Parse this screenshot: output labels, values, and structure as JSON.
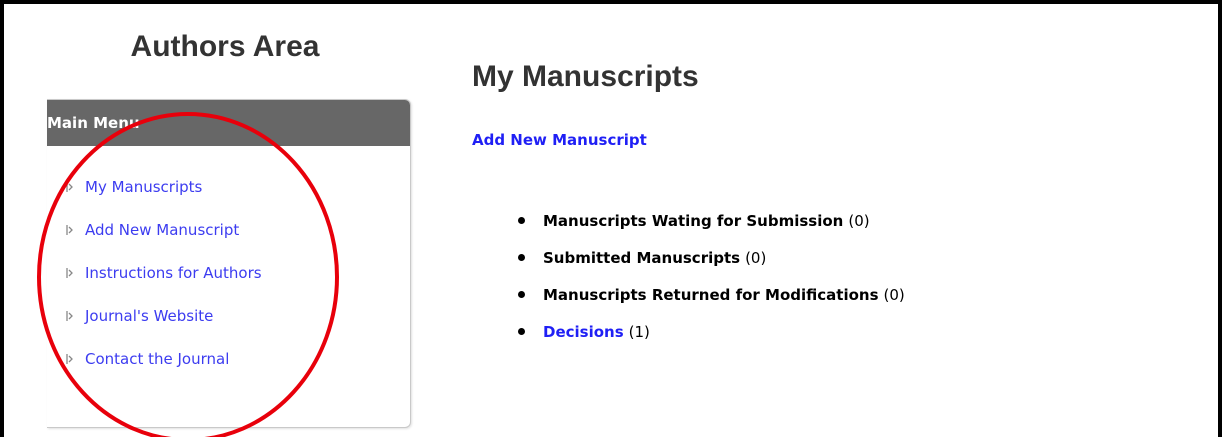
{
  "sidebar": {
    "title": "Authors Area",
    "menu_header": "Main Menu",
    "items": [
      {
        "label": "My Manuscripts"
      },
      {
        "label": "Add New Manuscript"
      },
      {
        "label": "Instructions for Authors"
      },
      {
        "label": "Journal's Website"
      },
      {
        "label": "Contact the Journal"
      }
    ]
  },
  "main": {
    "title": "My Manuscripts",
    "add_link": "Add New Manuscript",
    "statuses": [
      {
        "label": "Manuscripts Wating for Submission",
        "count": "(0)"
      },
      {
        "label": "Submitted Manuscripts",
        "count": "(0)"
      },
      {
        "label": "Manuscripts Returned for Modifications",
        "count": "(0)"
      },
      {
        "label": "Decisions",
        "count": "(1)"
      }
    ]
  },
  "colors": {
    "link": "#1f1ff5",
    "menu_header_bg": "#676767",
    "annotation": "#e8000b"
  },
  "icons": {
    "menu_bullet": "small-arrow-bullet-icon"
  }
}
